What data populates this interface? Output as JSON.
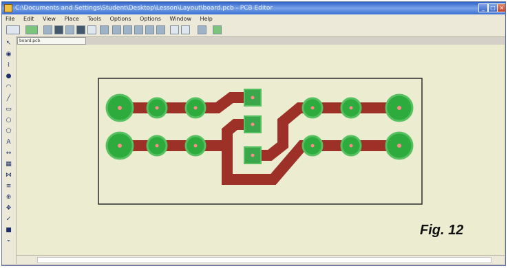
{
  "window": {
    "title": "C:\\Documents and Settings\\Student\\Desktop\\Lesson\\Layout\\board.pcb - PCB Editor",
    "controls": [
      "_",
      "□",
      "×"
    ]
  },
  "menu": [
    "File",
    "Edit",
    "View",
    "Place",
    "Tools",
    "Options",
    "Options",
    "Window",
    "Help"
  ],
  "toolbar": {
    "icons": [
      "select-tool-icon",
      "grid-icon",
      "new-icon",
      "open-icon",
      "save-icon",
      "print-icon",
      "cut-icon",
      "copy-icon",
      "zoom-in-icon",
      "zoom-out-icon",
      "zoom-fit-icon",
      "zoom-window-icon",
      "refresh-icon",
      "undo-icon",
      "redo-icon",
      "measure-icon",
      "help-icon"
    ]
  },
  "left_toolbar": {
    "icons": [
      "pointer-icon",
      "pad-icon",
      "track-icon",
      "via-icon",
      "arc-icon",
      "line-icon",
      "rectangle-icon",
      "circle-icon",
      "polygon-icon",
      "text-icon",
      "dimension-icon",
      "component-icon",
      "net-icon",
      "layer-icon",
      "zoom-icon",
      "pan-icon",
      "drc-icon",
      "fill-icon",
      "route-icon"
    ]
  },
  "document": {
    "tab_label": "board.pcb"
  },
  "pcb": {
    "colors": {
      "background": "#ecedd0",
      "outline": "#2a2a2a",
      "track": "#9e3127",
      "pad_fill": "#2dab3c",
      "pad_ring": "#57c060",
      "square_pad": "#3aa84a",
      "drill": "#ff8a8a"
    }
  },
  "figure_label": "Fig. 12"
}
